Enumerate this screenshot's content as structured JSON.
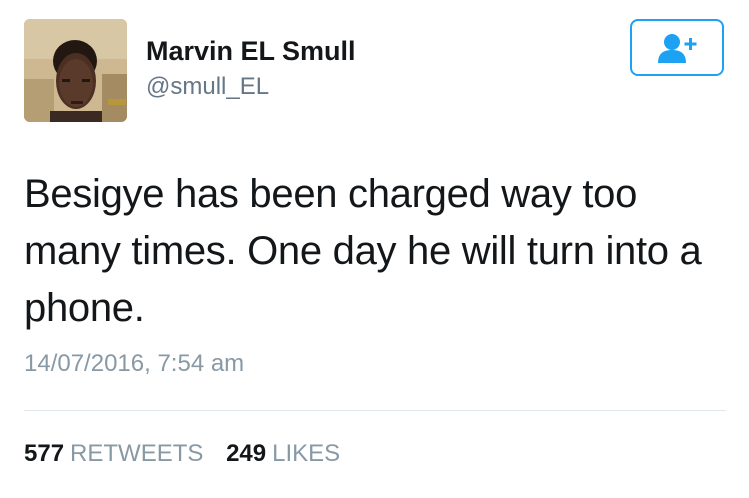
{
  "author": {
    "name": "Marvin EL Smull",
    "handle": "@smull_EL",
    "avatar_icon": "profile-photo"
  },
  "follow_button": {
    "icon": "add-user-icon",
    "accent_color": "#1da1f2"
  },
  "tweet": {
    "text": "Besigye has been charged way too many times. One day he will turn into a phone.",
    "timestamp": "14/07/2016, 7:54 am"
  },
  "stats": {
    "retweets_count": "577",
    "retweets_label": "RETWEETS",
    "likes_count": "249",
    "likes_label": "LIKES"
  },
  "colors": {
    "text": "#14171a",
    "secondary": "#657786",
    "muted": "#8899a6",
    "divider": "#e1e8ed"
  }
}
